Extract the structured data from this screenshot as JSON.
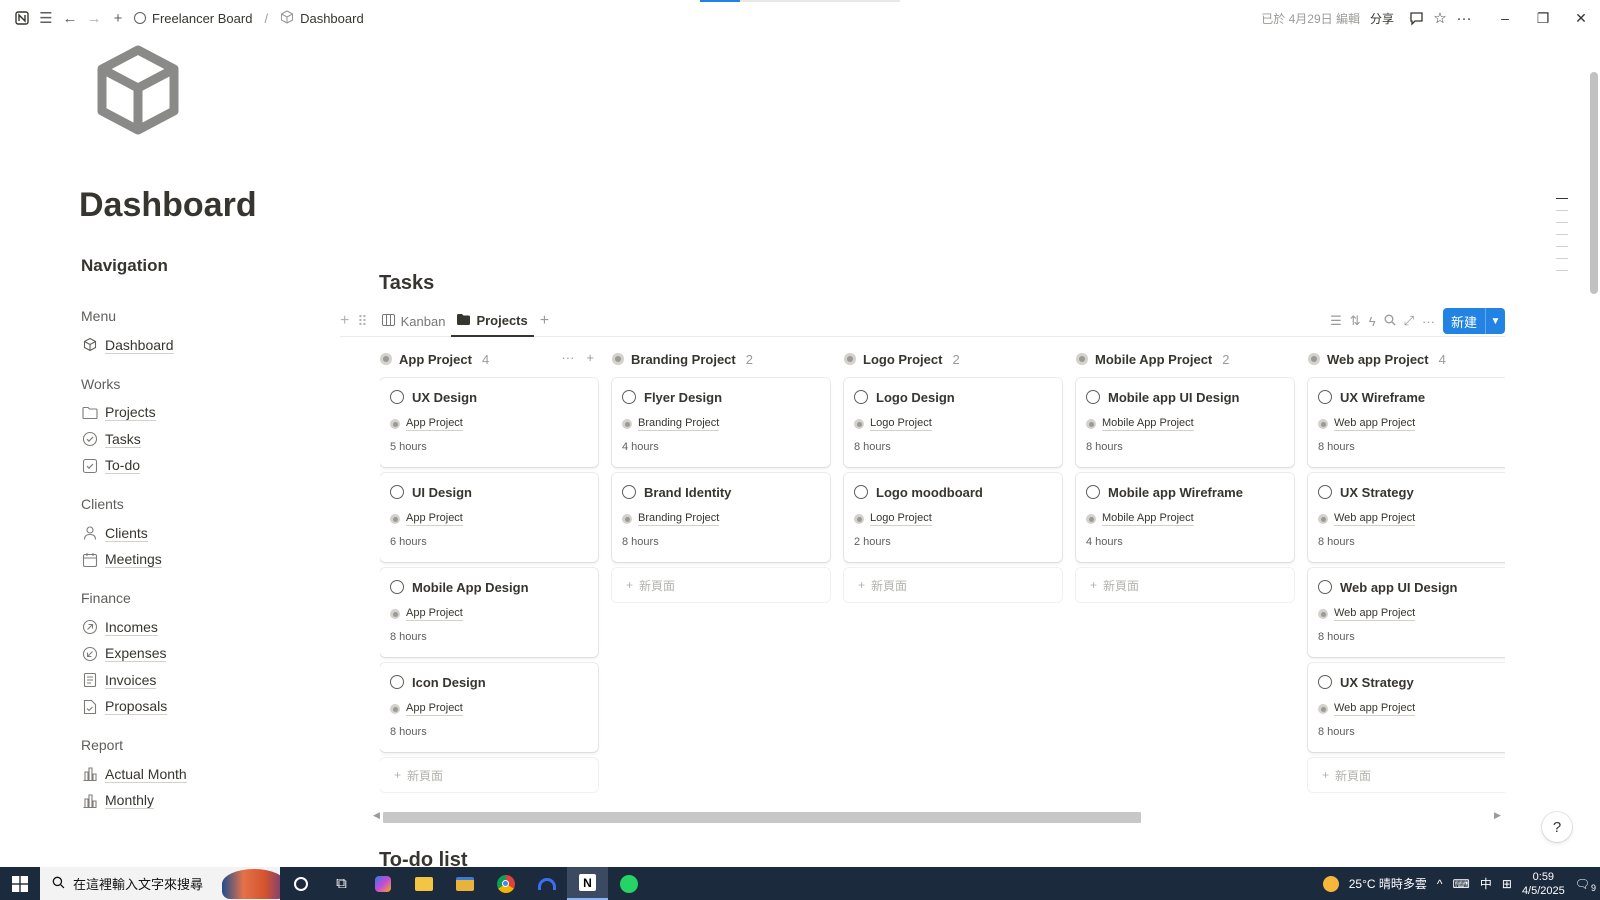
{
  "topbar": {
    "workspace_crumb": "Freelancer Board",
    "page_crumb": "Dashboard",
    "edited": "已於 4月29日 編輯",
    "share": "分享"
  },
  "page": {
    "title": "Dashboard",
    "icon": "cube-icon"
  },
  "nav": {
    "heading": "Navigation",
    "sections": [
      {
        "title": "Menu",
        "items": [
          {
            "label": "Dashboard",
            "icon": "cube-link-icon"
          }
        ]
      },
      {
        "title": "Works",
        "items": [
          {
            "label": "Projects",
            "icon": "folder-icon"
          },
          {
            "label": "Tasks",
            "icon": "check-circle-icon"
          },
          {
            "label": "To-do",
            "icon": "checkbox-icon"
          }
        ]
      },
      {
        "title": "Clients",
        "items": [
          {
            "label": "Clients",
            "icon": "person-icon"
          },
          {
            "label": "Meetings",
            "icon": "calendar-icon"
          }
        ]
      },
      {
        "title": "Finance",
        "items": [
          {
            "label": "Incomes",
            "icon": "arrow-up-right-circle-icon"
          },
          {
            "label": "Expenses",
            "icon": "arrow-down-left-circle-icon"
          },
          {
            "label": "Invoices",
            "icon": "document-icon"
          },
          {
            "label": "Proposals",
            "icon": "document-check-icon"
          }
        ]
      },
      {
        "title": "Report",
        "items": [
          {
            "label": "Actual Month",
            "icon": "bar-chart-icon"
          },
          {
            "label": "Monthly",
            "icon": "bar-chart-icon"
          }
        ]
      }
    ]
  },
  "tasks": {
    "title": "Tasks",
    "tabs": [
      {
        "label": "Kanban",
        "active": false
      },
      {
        "label": "Projects",
        "active": true
      }
    ],
    "new_button": "新建",
    "new_card_label": "新頁面",
    "columns": [
      {
        "name": "App Project",
        "count": "4",
        "cards": [
          {
            "title": "UX Design",
            "project": "App Project",
            "hours": "5 hours"
          },
          {
            "title": "UI Design",
            "project": "App Project",
            "hours": "6 hours"
          },
          {
            "title": "Mobile App Design",
            "project": "App Project",
            "hours": "8 hours"
          },
          {
            "title": "Icon Design",
            "project": "App Project",
            "hours": "8 hours"
          }
        ]
      },
      {
        "name": "Branding Project",
        "count": "2",
        "cards": [
          {
            "title": "Flyer Design",
            "project": "Branding Project",
            "hours": "4 hours"
          },
          {
            "title": "Brand Identity",
            "project": "Branding Project",
            "hours": "8 hours"
          }
        ]
      },
      {
        "name": "Logo Project",
        "count": "2",
        "cards": [
          {
            "title": "Logo Design",
            "project": "Logo Project",
            "hours": "8 hours"
          },
          {
            "title": "Logo moodboard",
            "project": "Logo Project",
            "hours": "2 hours"
          }
        ]
      },
      {
        "name": "Mobile App Project",
        "count": "2",
        "cards": [
          {
            "title": "Mobile app UI Design",
            "project": "Mobile App Project",
            "hours": "8 hours"
          },
          {
            "title": "Mobile app Wireframe",
            "project": "Mobile App Project",
            "hours": "4 hours"
          }
        ]
      },
      {
        "name": "Web app Project",
        "count": "4",
        "cards": [
          {
            "title": "UX Wireframe",
            "project": "Web app Project",
            "hours": "8 hours"
          },
          {
            "title": "UX Strategy",
            "project": "Web app Project",
            "hours": "8 hours"
          },
          {
            "title": "Web app UI Design",
            "project": "Web app Project",
            "hours": "8 hours"
          },
          {
            "title": "UX Strategy",
            "project": "Web app Project",
            "hours": "8 hours"
          }
        ]
      }
    ]
  },
  "todo": {
    "title": "To-do list"
  },
  "taskbar": {
    "search_placeholder": "在這裡輸入文字來搜尋",
    "weather": "25°C 晴時多雲",
    "ime": "中",
    "time": "0:59",
    "date": "4/5/2025",
    "notifications": "9"
  },
  "colors": {
    "accent": "#2383e2",
    "text": "#37352f",
    "taskbar": "#1c2a3d"
  }
}
